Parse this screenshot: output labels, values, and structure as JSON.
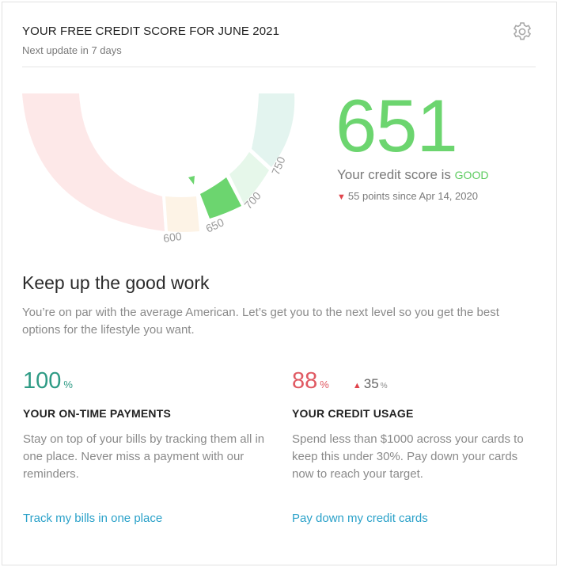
{
  "header": {
    "title": "YOUR FREE CREDIT SCORE FOR JUNE 2021",
    "subtitle": "Next update in 7 days",
    "settings_icon": "gear-icon"
  },
  "score": {
    "value": "651",
    "label_prefix": "Your credit score is",
    "rating": "GOOD",
    "change_text": "55 points since Apr 14, 2020",
    "change_direction": "down",
    "score_color": "#6cd56f",
    "rating_color": "#5ccb5f",
    "down_color": "#e0444c"
  },
  "gauge": {
    "tick_labels": [
      "600",
      "650",
      "700",
      "750"
    ],
    "segment_colors": [
      "#fde8e8",
      "#fdf3e6",
      "#6cd56f",
      "#e6f7ea",
      "#e3f4ef"
    ]
  },
  "advice": {
    "heading": "Keep up the good work",
    "description": "You’re on par with the average American. Let’s get you to the next level so you get the best options for the lifestyle you want."
  },
  "metrics": [
    {
      "value": "100",
      "unit": "%",
      "title": "YOUR ON-TIME PAYMENTS",
      "text": "Stay on top of your bills by tracking them all in one place. Never miss a payment with our reminders.",
      "link": "Track my bills in one place",
      "color": "#2e9b85"
    },
    {
      "value": "88",
      "unit": "%",
      "delta_value": "35",
      "delta_unit": "%",
      "delta_direction": "up",
      "title": "YOUR CREDIT USAGE",
      "text": "Spend less than $1000 across your cards to keep this under 30%. Pay down your cards now to reach your target.",
      "link": "Pay down my credit cards",
      "color": "#e05a63"
    }
  ]
}
